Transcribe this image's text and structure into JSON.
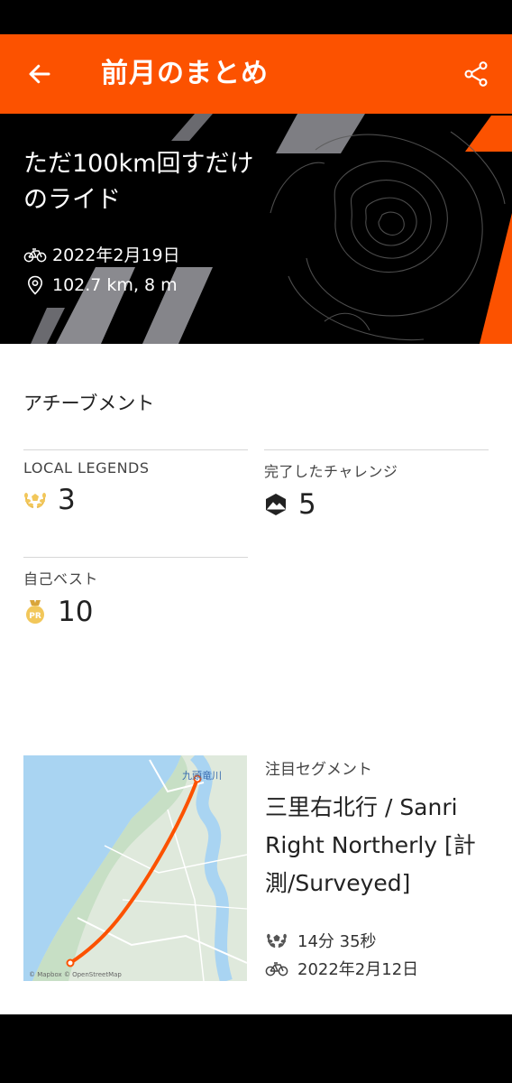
{
  "app_bar": {
    "title": "前月のまとめ",
    "back_icon": "arrow-left-icon",
    "share_icon": "share-icon",
    "background_color": "#fc5200"
  },
  "hero": {
    "title": "ただ100km回すだけのライド",
    "date": "2022年2月19日",
    "distance": "102.7 km, 8 m",
    "date_icon": "bike-icon",
    "distance_icon": "location-pin-icon"
  },
  "achievements": {
    "title": "アチーブメント",
    "local_legends": {
      "label": "LOCAL LEGENDS",
      "value": "3",
      "icon": "laurel-icon"
    },
    "challenges": {
      "label": "完了したチャレンジ",
      "value": "5",
      "icon": "challenge-badge-icon"
    },
    "personal_best": {
      "label": "自己ベスト",
      "value": "10",
      "icon": "pr-medal-icon"
    }
  },
  "segment": {
    "kicker": "注目セグメント",
    "name": "三里右北行 / Sanri Right Northerly [計測/Surveyed]",
    "time": "14分 35秒",
    "date": "2022年2月12日",
    "map_label": "九頭竜川",
    "map_attribution": "© Mapbox © OpenStreetMap",
    "time_icon": "laurel-icon",
    "date_icon": "bike-icon"
  }
}
